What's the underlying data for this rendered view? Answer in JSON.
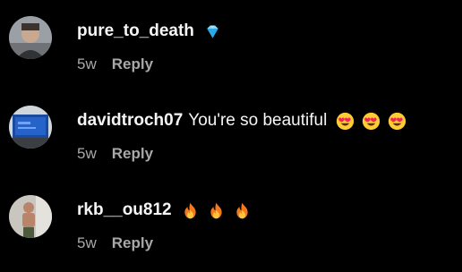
{
  "comments": [
    {
      "username": "pure_to_death",
      "text": "",
      "emojis": [
        "gem-icon"
      ],
      "time": "5w",
      "reply_label": "Reply"
    },
    {
      "username": "davidtroch07",
      "text": "You're so beautiful",
      "emojis": [
        "heart-eyes-icon",
        "heart-eyes-icon",
        "heart-eyes-icon"
      ],
      "time": "5w",
      "reply_label": "Reply"
    },
    {
      "username": "rkb__ou812",
      "text": "",
      "emojis": [
        "fire-icon",
        "fire-icon",
        "fire-icon"
      ],
      "time": "5w",
      "reply_label": "Reply"
    }
  ],
  "colors": {
    "background": "#000000",
    "text": "#f5f5f5",
    "secondary": "#a8a8a8"
  }
}
